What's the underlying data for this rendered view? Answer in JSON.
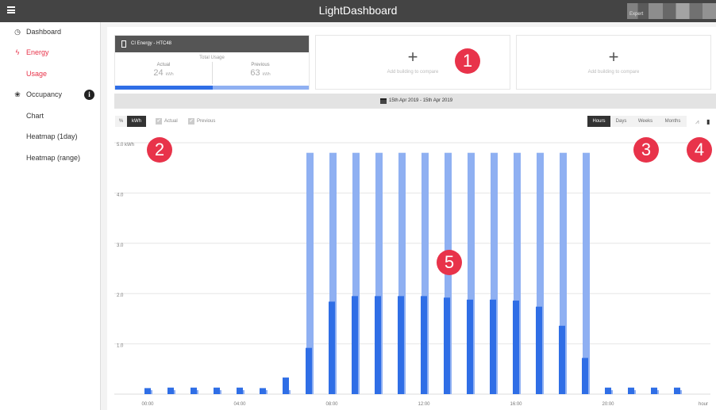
{
  "app": {
    "title": "LightDashboard",
    "user_label": "Expert"
  },
  "sidebar": {
    "items": [
      {
        "label": "Dashboard",
        "icon": "dashboard-icon",
        "glyph": "◷"
      },
      {
        "label": "Energy",
        "icon": "bolt-icon",
        "glyph": "ϟ"
      },
      {
        "label": "Usage"
      },
      {
        "label": "Occupancy",
        "icon": "paw-icon",
        "glyph": "❀",
        "badge": "i"
      },
      {
        "label": "Chart"
      },
      {
        "label": "Heatmap (1day)"
      },
      {
        "label": "Heatmap (range)"
      }
    ],
    "active_color": "#e8334a"
  },
  "building_card": {
    "name": "CI Energy - HTC48",
    "total_label": "Total Usage",
    "actual_label": "Actual",
    "actual_value": "24",
    "actual_unit": "kWh",
    "previous_label": "Previous",
    "previous_value": "63",
    "previous_unit": "kWh"
  },
  "compare_cards": [
    {
      "plus": "+",
      "label": "Add building to compare"
    },
    {
      "plus": "+",
      "label": "Add building to compare"
    }
  ],
  "date_range": "15th Apr 2019 - 15th Apr 2019",
  "toolbar": {
    "percent_label": "%",
    "kwh_label": "kWh",
    "actual_label": "Actual",
    "previous_label": "Previous",
    "check_glyph": "✔",
    "period_buttons": [
      "Hours",
      "Days",
      "Weeks",
      "Months"
    ],
    "selected_period": "Hours",
    "line_icon_glyph": "⩘",
    "bar_icon_glyph": "▮"
  },
  "callouts": [
    "1",
    "2",
    "3",
    "4",
    "5"
  ],
  "chart_data": {
    "type": "bar",
    "ylabel": "kWh",
    "ylim": [
      0,
      5.0
    ],
    "y_ticks": [
      "1.0",
      "2.0",
      "3.0",
      "4.0",
      "5.0 kWh"
    ],
    "x_ticks": [
      "00:00",
      "04:00",
      "08:00",
      "12:00",
      "16:00",
      "20:00"
    ],
    "x_unit": "hour",
    "categories": [
      "00",
      "01",
      "02",
      "03",
      "04",
      "05",
      "06",
      "07",
      "08",
      "09",
      "10",
      "11",
      "12",
      "13",
      "14",
      "15",
      "16",
      "17",
      "18",
      "19",
      "20",
      "21",
      "22",
      "23"
    ],
    "series": [
      {
        "name": "Actual",
        "color": "#2f6ee6",
        "values": [
          0.12,
          0.13,
          0.13,
          0.13,
          0.13,
          0.12,
          0.33,
          0.92,
          1.84,
          1.95,
          1.95,
          1.95,
          1.95,
          1.92,
          1.88,
          1.88,
          1.86,
          1.74,
          1.36,
          0.72,
          0.13,
          0.13,
          0.13,
          0.13
        ]
      },
      {
        "name": "Previous",
        "color": "#8fb0f2",
        "values": [
          0.08,
          0.08,
          0.08,
          0.08,
          0.08,
          0.08,
          0.08,
          4.8,
          4.8,
          4.8,
          4.8,
          4.8,
          4.8,
          4.8,
          4.8,
          4.8,
          4.8,
          4.8,
          4.8,
          4.8,
          0.08,
          0.08,
          0.08,
          0.08
        ]
      }
    ],
    "grid": true,
    "legend": "none"
  }
}
